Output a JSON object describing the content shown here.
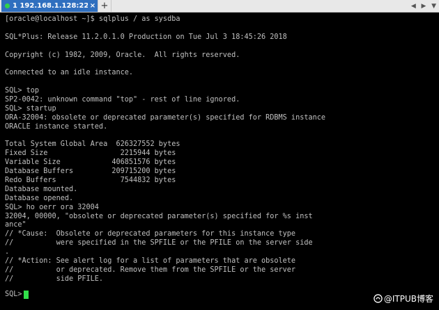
{
  "tab": {
    "label": "1 192.168.1.128:22",
    "close": "×"
  },
  "newtab_label": "+",
  "tabnav": {
    "left": "◀",
    "right": "▶",
    "menu": "▼"
  },
  "terminal": {
    "lines": [
      "[oracle@localhost ~]$ sqlplus / as sysdba",
      "",
      "SQL*Plus: Release 11.2.0.1.0 Production on Tue Jul 3 18:45:26 2018",
      "",
      "Copyright (c) 1982, 2009, Oracle.  All rights reserved.",
      "",
      "Connected to an idle instance.",
      "",
      "SQL> top",
      "SP2-0042: unknown command \"top\" - rest of line ignored.",
      "SQL> startup",
      "ORA-32004: obsolete or deprecated parameter(s) specified for RDBMS instance",
      "ORACLE instance started.",
      "",
      "Total System Global Area  626327552 bytes",
      "Fixed Size                 2215944 bytes",
      "Variable Size            406851576 bytes",
      "Database Buffers         209715200 bytes",
      "Redo Buffers               7544832 bytes",
      "Database mounted.",
      "Database opened.",
      "SQL> ho oerr ora 32004",
      "32004, 00000, \"obsolete or deprecated parameter(s) specified for %s inst",
      "ance\"",
      "// *Cause:  Obsolete or deprecated parameters for this instance type",
      "//          were specified in the SPFILE or the PFILE on the server side",
      ".",
      "// *Action: See alert log for a list of parameters that are obsolete",
      "//          or deprecated. Remove them from the SPFILE or the server",
      "//          side PFILE."
    ],
    "prompt": "SQL>",
    "cursor_color": "#31e04a"
  },
  "watermark": {
    "text": "@ITPUB博客"
  },
  "colors": {
    "tab_active": "#2f6fbf",
    "status_dot": "#31d14a",
    "terminal_bg": "#000000",
    "terminal_fg": "#c0c0c0"
  }
}
